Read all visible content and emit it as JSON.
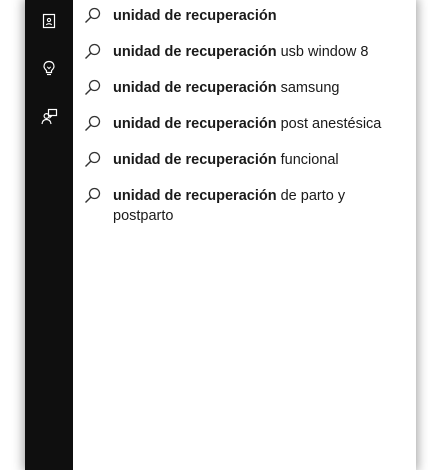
{
  "rail": {
    "icons": [
      "contact-card-icon",
      "lightbulb-icon",
      "feedback-person-icon"
    ]
  },
  "suggestions": [
    {
      "query": "unidad de recuperación",
      "completion": ""
    },
    {
      "query": "unidad de recuperación",
      "completion": " usb window 8"
    },
    {
      "query": "unidad de recuperación",
      "completion": " samsung"
    },
    {
      "query": "unidad de recuperación",
      "completion": " post anestésica"
    },
    {
      "query": "unidad de recuperación",
      "completion": " funcional"
    },
    {
      "query": "unidad de recuperación",
      "completion": " de parto y postparto"
    }
  ],
  "colors": {
    "rail_bg": "#0f0f0f",
    "text": "#1a1a1a",
    "panel_bg": "#ffffff"
  }
}
